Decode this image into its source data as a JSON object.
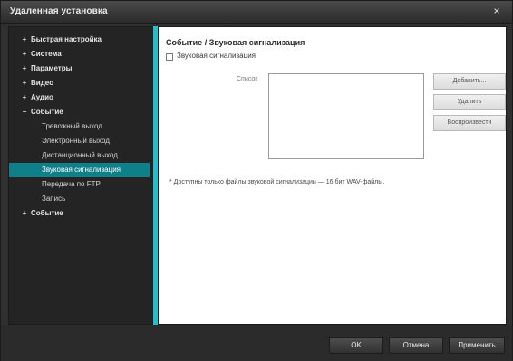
{
  "window": {
    "title": "Удаленная установка",
    "close_glyph": "×"
  },
  "sidebar": {
    "items": [
      {
        "label": "Быстрая настройка",
        "expander": "+"
      },
      {
        "label": "Система",
        "expander": "+"
      },
      {
        "label": "Параметры",
        "expander": "+"
      },
      {
        "label": "Видео",
        "expander": "+"
      },
      {
        "label": "Аудио",
        "expander": "+"
      },
      {
        "label": "Событие",
        "expander": "−"
      },
      {
        "label": "Тревожный выход"
      },
      {
        "label": "Электронный выход"
      },
      {
        "label": "Дистанционный выход"
      },
      {
        "label": "Звуковая сигнализация"
      },
      {
        "label": "Передача по FTP"
      },
      {
        "label": "Запись"
      },
      {
        "label": "Событие",
        "expander": "+"
      }
    ],
    "selected_index": 9
  },
  "main": {
    "heading": "Событие / Звуковая сигнализация",
    "checkbox_label": "Звуковая сигнализация",
    "field_label": "Список",
    "buttons": [
      "Добавить...",
      "Удалить",
      "Воспроизвести"
    ],
    "note": "* Доступны только файлы звуковой сигнализации — 16 бит WAV-файлы."
  },
  "footer": {
    "ok": "OK",
    "cancel": "Отмена",
    "apply": "Применить"
  }
}
